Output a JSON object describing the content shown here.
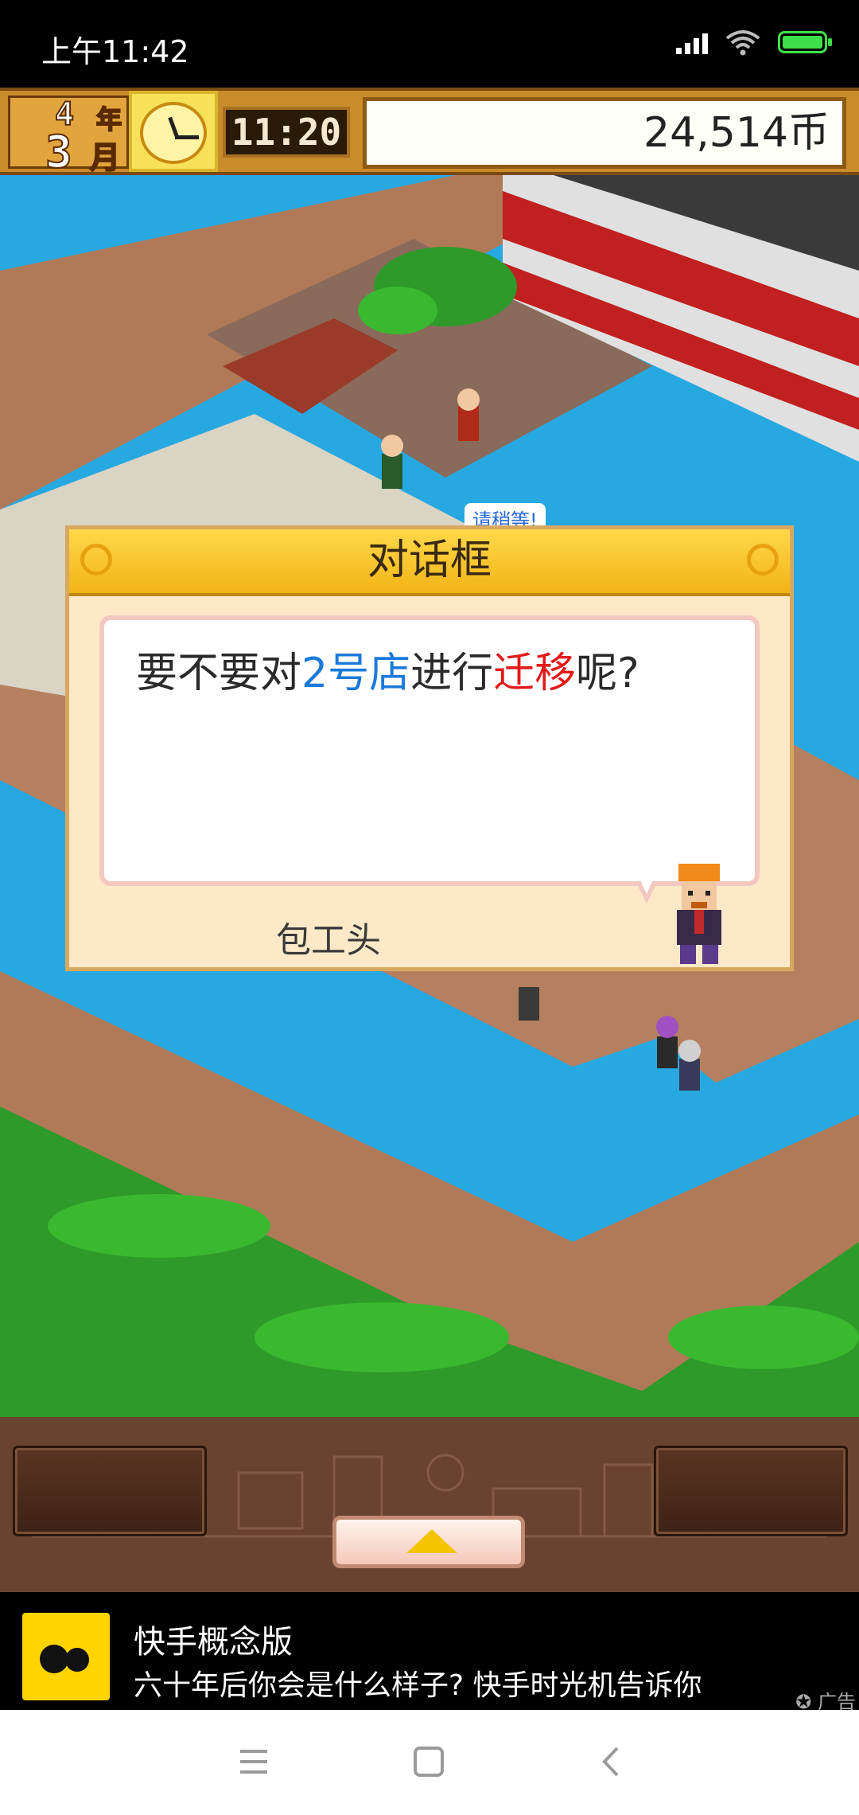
{
  "status_bar": {
    "time": "上午11:42"
  },
  "hud": {
    "year": "4",
    "year_unit": "年",
    "month": "3",
    "month_unit": "月",
    "game_time": "11:20",
    "money": "24,514币"
  },
  "dialog": {
    "title": "对话框",
    "message": {
      "part1": "要不要对",
      "store": "2号店",
      "part2": "进行",
      "action": "迁移",
      "part3": "呢?"
    },
    "speaker": "包工头"
  },
  "game_world": {
    "floating_label": "请稍等!"
  },
  "ad": {
    "title": "快手概念版",
    "description": "六十年后你会是什么样子? 快手时光机告诉你",
    "tag": "广告"
  },
  "colors": {
    "water": "#28a8e0",
    "boardwalk": "#b07a58",
    "trees": "#2e9a2a",
    "dialog_title_bg": "#ffd84a",
    "highlight_blue": "#1a7ad8",
    "highlight_red": "#e21a1a"
  },
  "icons": {
    "signal": "cellular-signal-icon",
    "wifi": "wifi-icon",
    "battery": "battery-charging-icon",
    "clock": "analog-clock-icon",
    "up_arrow": "up-triangle-icon",
    "nav_menu": "menu-icon",
    "nav_home": "home-square-icon",
    "nav_back": "back-chevron-icon"
  }
}
